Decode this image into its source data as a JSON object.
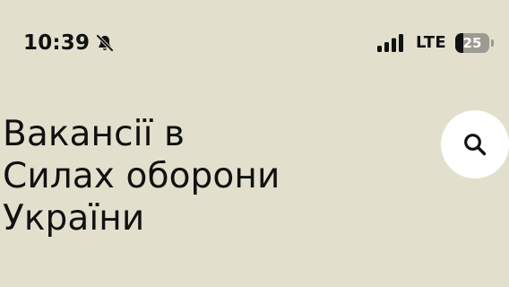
{
  "status_bar": {
    "time": "10:39",
    "mute_icon": "bell-slash-icon",
    "signal_icon": "cellular-signal-icon",
    "network": "LTE",
    "battery_percent": 25,
    "battery_text": "25"
  },
  "header": {
    "title_lines": [
      "Вакансії в",
      "Силах оборони",
      "України"
    ],
    "search_icon": "search-icon"
  },
  "colors": {
    "background": "#e2e0cd",
    "text": "#111111",
    "search_button_bg": "#ffffff"
  }
}
